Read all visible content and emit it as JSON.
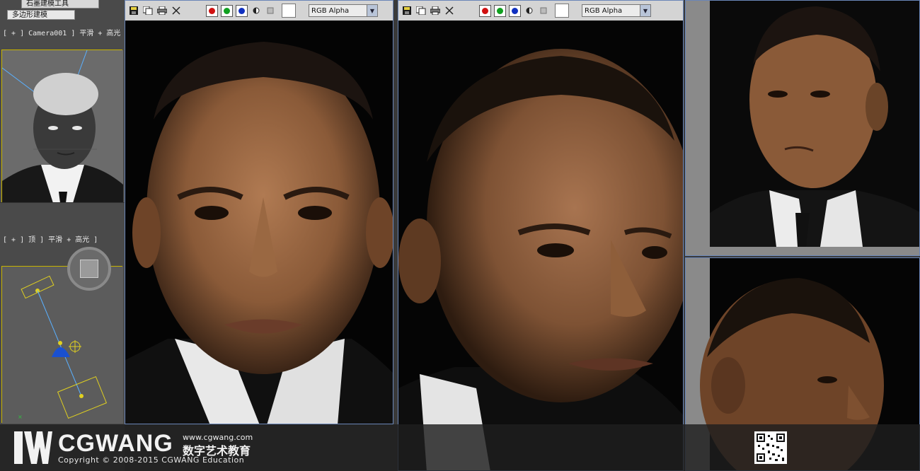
{
  "left_panel": {
    "ribbon_tab_top": "石墨建模工具",
    "ribbon_tab_sub": "多边形建模",
    "viewport_persp_label": "[ + ] Camera001 ] 平滑 + 高光 ]",
    "viewport_top_label": "[ + ] 顶 ] 平滑 + 高光 ]"
  },
  "frames": [
    {
      "channel": "RGB Alpha"
    },
    {
      "channel": "RGB Alpha"
    }
  ],
  "toolbar_icons": [
    "save-icon",
    "copy-icon",
    "print-icon",
    "clear-icon"
  ],
  "channel_colors": {
    "red": "#d01010",
    "green": "#10a020",
    "blue": "#1030c0"
  },
  "watermark": {
    "url": "www.cgwang.com",
    "brand": "CGWANG",
    "brand_cn": "数字艺术教育",
    "copyright": "Copyright © 2008-2015 CGWANG Education"
  }
}
